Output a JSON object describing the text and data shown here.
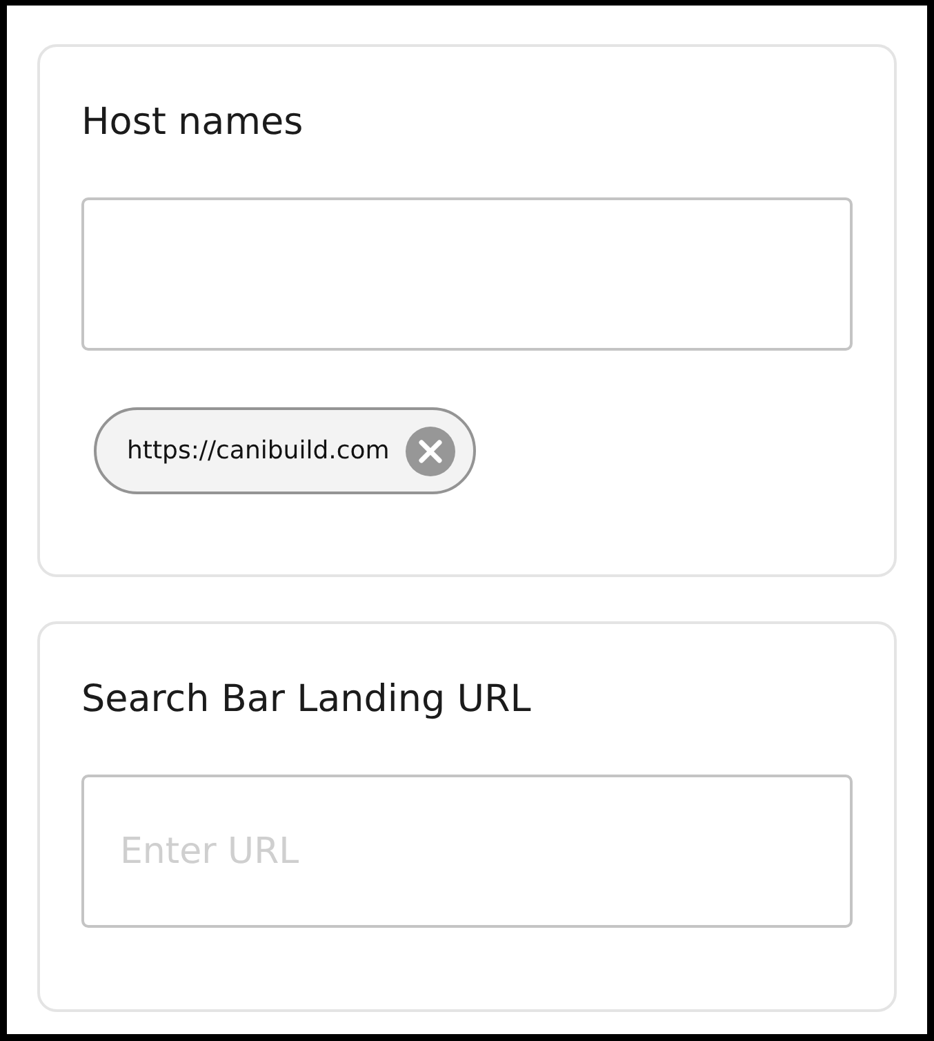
{
  "sections": [
    {
      "kind": "tags",
      "title": "Host names",
      "tags": [
        {
          "label": "https://canibuild.com"
        }
      ]
    },
    {
      "kind": "url",
      "title": "Search Bar Landing URL",
      "input": {
        "placeholder": "Enter URL"
      }
    }
  ]
}
